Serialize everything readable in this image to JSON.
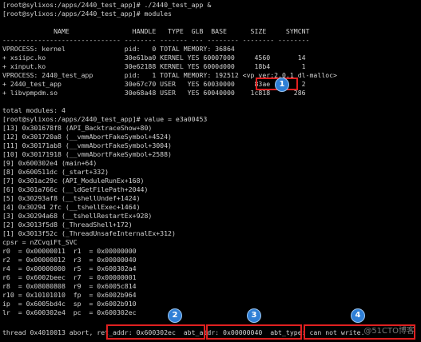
{
  "terminal": {
    "lines": [
      "[root@sylixos:/apps/2440_test_app]# ./2440_test_app &",
      "[root@sylixos:/apps/2440_test_app]# modules",
      "",
      "             NAME                HANDLE   TYPE  GLB  BASE      SIZE     SYMCNT",
      "------------------------------ -------- ------- --- -------- -------- --------",
      "VPROCESS: kernel               pid:   0 TOTAL MEMORY: 36864",
      "+ xsiipc.ko                    30e61ba0 KERNEL YES 60007000     4560       14",
      "+ xinput.ko                    30e62188 KERNEL YES 6000d000     18b4        1",
      "VPROCESS: 2440_test_app        pid:   1 TOTAL MEMORY: 192512 <vp ver:2.0.1 dl-malloc>",
      "+ 2440_test_app                30e67c70 USER   YES 60030000     83ae        2",
      "+ libvpmpdm.so                 30e68a48 USER   YES 60040000    1c818      286",
      "",
      "total modules: 4",
      "[root@sylixos:/apps/2440_test_app]# value = e3a00453",
      "[13] 0x301678f8 (API_BacktraceShow+80)",
      "[12] 0x301720a8 (__vmmAbortFakeSymbol+4524)",
      "[11] 0x30171ab8 (__vmmAbortFakeSymbol+3004)",
      "[10] 0x30171918 (__vmmAbortFakeSymbol+2588)",
      "[9] 0x600302e4 (main+64)",
      "[8] 0x600511dc (_start+332)",
      "[7] 0x301ac29c (API_ModuleRunEx+168)",
      "[6] 0x301a766c (__ldGetFilePath+2044)",
      "[5] 0x30293af8 (__tshellUndef+1424)",
      "[4] 0x30294 2fc (__tshellExec+1464)",
      "[3] 0x30294a68 (__tshellRestartEx+928)",
      "[2] 0x3013f5d8 (_ThreadShell+172)",
      "[1] 0x3013f52c (_ThreadUnsafeInternalEx+312)",
      "cpsr = nZCvqiFt_SVC",
      "r0  = 0x00000011  r1  = 0x00000000",
      "r2  = 0x00000012  r3  = 0x00000040",
      "r4  = 0x00000000  r5  = 0x600302a4",
      "r6  = 0x6002beec  r7  = 0x00000001",
      "r8  = 0x08080808  r9  = 0x6005c814",
      "r10 = 0x10101010  fp  = 0x6002b964",
      "ip  = 0x6005bd4c  sp  = 0x6002b910",
      "lr  = 0x600302e4  pc  = 0x600302ec",
      "thread 0x4010013 abort, ret_addr: 0x600302ec  abt_addr: 0x00000040  abt_type: can not write."
    ],
    "callout_labels": [
      "1",
      "2",
      "3",
      "4"
    ],
    "watermark": "@51CTO博客",
    "colors": {
      "background": "#000000",
      "text": "#d2d2d2",
      "callout": "#e02020",
      "badge": "#2f7fd6"
    }
  }
}
